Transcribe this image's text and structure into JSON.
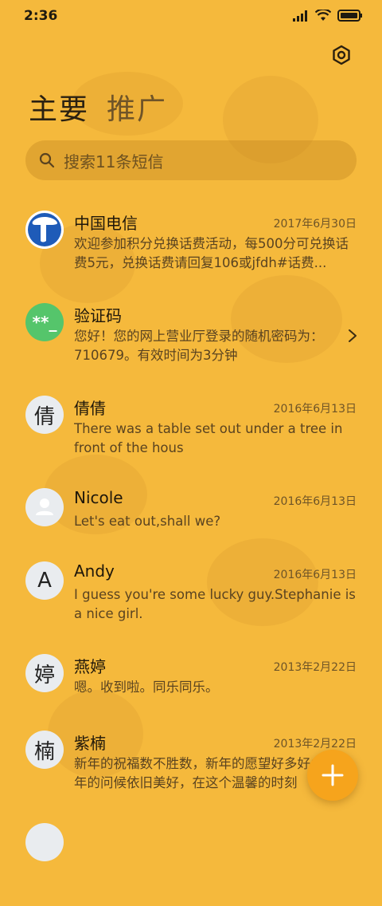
{
  "status": {
    "time": "2:36"
  },
  "tabs": [
    {
      "label": "主要"
    },
    {
      "label": "推广"
    }
  ],
  "search": {
    "placeholder": "搜索11条短信"
  },
  "threads": [
    {
      "avatar": "",
      "name": "中国电信",
      "date": "2017年6月30日",
      "preview": "欢迎参加积分兑换话费活动，每500分可兑换话费5元，兑换话费请回复106或jfdh#话费..."
    },
    {
      "avatar": "**_",
      "name": "验证码",
      "date": "",
      "preview": "您好！您的网上营业厅登录的随机密码为：710679。有效时间为3分钟"
    },
    {
      "avatar": "倩",
      "name": "倩倩",
      "date": "2016年6月13日",
      "preview": "There was a table set out under a tree in front of the hous"
    },
    {
      "avatar": "",
      "name": "Nicole",
      "date": "2016年6月13日",
      "preview": "Let's eat out,shall we?"
    },
    {
      "avatar": "A",
      "name": "Andy",
      "date": "2016年6月13日",
      "preview": "I guess you're some lucky guy.Stephanie is a nice girl."
    },
    {
      "avatar": "婷",
      "name": "燕婷",
      "date": "2013年2月22日",
      "preview": "嗯。收到啦。同乐同乐。"
    },
    {
      "avatar": "楠",
      "name": "紫楠",
      "date": "2013年2月22日",
      "preview": "新年的祝福数不胜数，新年的愿望好多好多，新年的问候依旧美好，在这个温馨的时刻"
    }
  ],
  "colors": {
    "background": "#F5B93C",
    "fab": "#F6A41C",
    "telecom_blue": "#1E5BB8",
    "verify_green": "#55C56B"
  }
}
